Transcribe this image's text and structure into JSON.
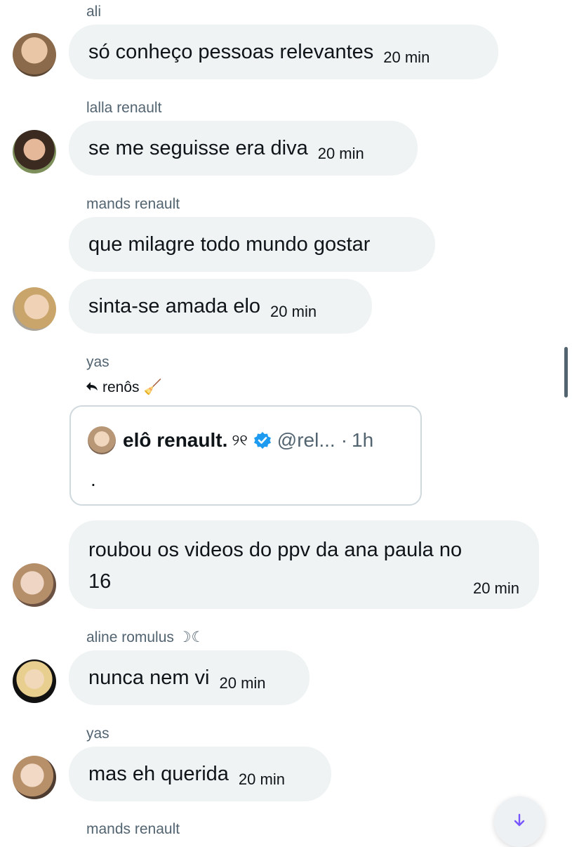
{
  "messages": [
    {
      "sender": "ali",
      "text": "só conheço pessoas relevantes",
      "time": "20 min"
    },
    {
      "sender": "lalla renault",
      "text": "se me seguisse era diva",
      "time": "20 min"
    },
    {
      "sender": "mands renault",
      "text": "que milagre todo mundo gostar",
      "text2": "sinta-se amada elo",
      "time2": "20 min"
    },
    {
      "sender": "yas",
      "reply_label": "renôs",
      "reply_emoji": "🧹",
      "quote": {
        "name": "elô renault.",
        "emoji": "୨୧",
        "handle": "@rel...",
        "separator": "·",
        "time": "1h",
        "body": "."
      },
      "text": "roubou os videos do ppv da ana paula no 16",
      "time": "20 min"
    },
    {
      "sender": "aline romulus ☽☾",
      "text": "nunca nem vi",
      "time": "20 min"
    },
    {
      "sender": "yas",
      "text": "mas eh querida",
      "time": "20 min"
    },
    {
      "sender": "mands renault"
    }
  ],
  "colors": {
    "bubble": "#eff3f4",
    "secondary_text": "#536471",
    "verified": "#1d9bf0",
    "scroll_arrow": "#7856ff"
  },
  "icons": {
    "reply": "reply-arrow-icon",
    "verified": "verified-badge-icon",
    "scroll": "arrow-down-icon"
  }
}
